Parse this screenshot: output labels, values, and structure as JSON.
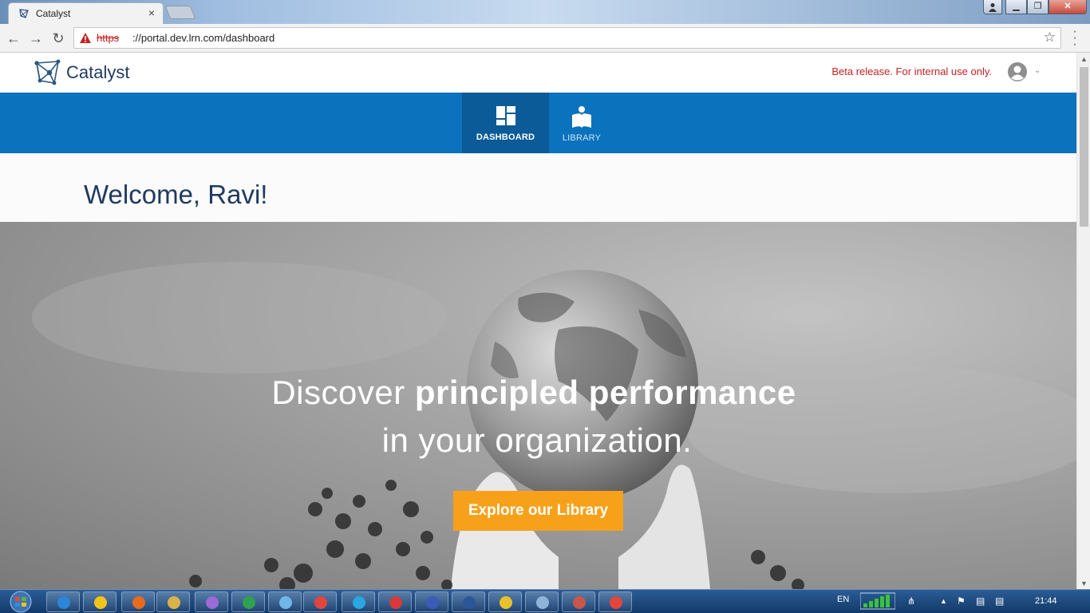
{
  "browser": {
    "tab_title": "Catalyst",
    "tab_close": "×",
    "url_scheme": "https",
    "url_rest": "://portal.dev.lrn.com/dashboard",
    "window_controls": {
      "minimize": "▁",
      "maximize": "❐",
      "close": "✕"
    }
  },
  "header": {
    "logo_text": "Catalyst",
    "beta_notice": "Beta release. For internal use only."
  },
  "nav": {
    "tabs": [
      {
        "label": "DASHBOARD",
        "icon": "dashboard-icon",
        "active": true
      },
      {
        "label": "LIBRARY",
        "icon": "library-icon",
        "active": false
      }
    ]
  },
  "welcome": {
    "text": "Welcome, Ravi!"
  },
  "hero": {
    "line1_plain": "Discover ",
    "line1_bold": "principled performance",
    "line2": "in your organization.",
    "cta_label": "Explore our Library"
  },
  "taskbar": {
    "language": "EN",
    "clock": "21:44",
    "apps": [
      "ie-icon",
      "outlook-icon",
      "firefox-icon",
      "explorer-icon",
      "paint-icon",
      "hangouts-icon",
      "messenger-icon",
      "chrome-icon",
      "skype-icon",
      "cisco-icon",
      "vpn-icon",
      "word-icon",
      "pidgin-icon",
      "folder-icon",
      "tools-icon",
      "chrome-icon"
    ]
  },
  "colors": {
    "nav_blue": "#0b72bd",
    "nav_active": "#0a5b98",
    "cta_orange": "#f7a11a",
    "beta_red": "#c5221f",
    "brand_navy": "#1f3a5f"
  }
}
